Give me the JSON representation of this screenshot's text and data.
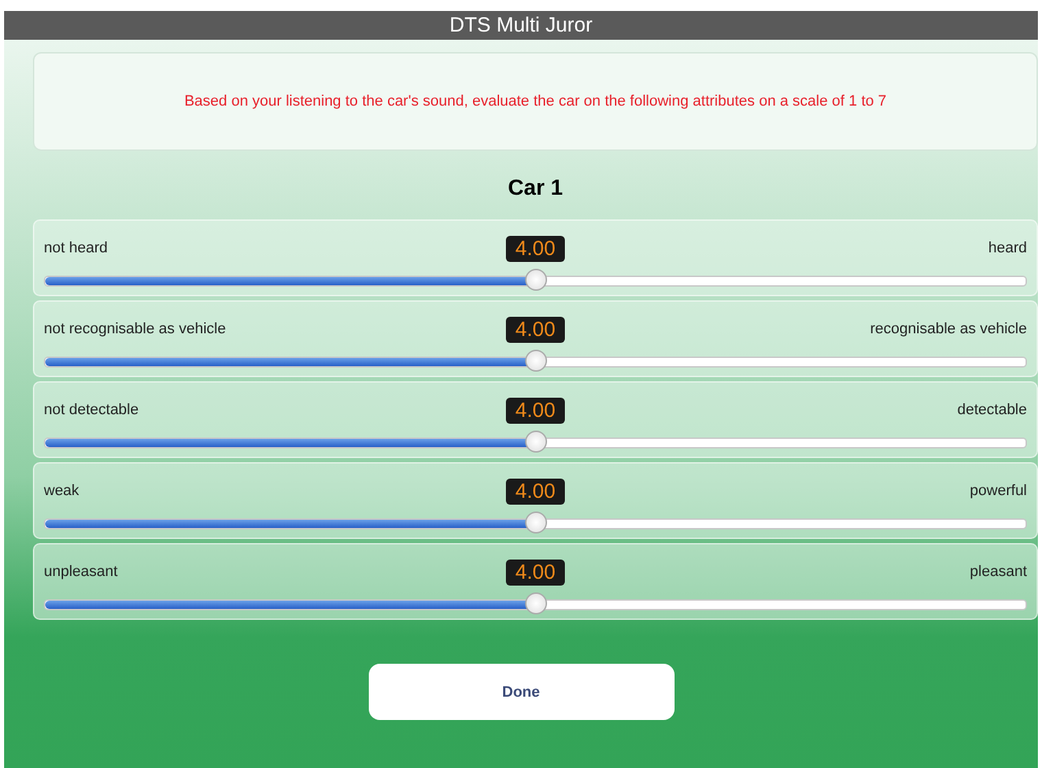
{
  "window": {
    "title": "DTS Multi Juror"
  },
  "instruction": "Based on your listening to the car's sound, evaluate the car on the following attributes on a scale of 1 to 7",
  "heading": "Car 1",
  "attributes": [
    {
      "low": "not heard",
      "high": "heard",
      "reading": "4.00",
      "level": 0.5
    },
    {
      "low": "not recognisable as vehicle",
      "high": "recognisable as vehicle",
      "reading": "4.00",
      "level": 0.5
    },
    {
      "low": "not detectable",
      "high": "detectable",
      "reading": "4.00",
      "level": 0.5
    },
    {
      "low": "weak",
      "high": "powerful",
      "reading": "4.00",
      "level": 0.5
    },
    {
      "low": "unpleasant",
      "high": "pleasant",
      "reading": "4.00",
      "level": 0.5
    }
  ],
  "done_button": "Done"
}
